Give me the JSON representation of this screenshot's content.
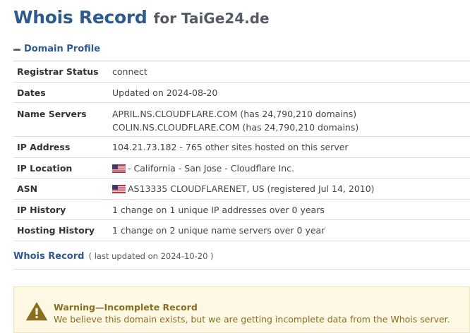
{
  "header": {
    "title": "Whois Record",
    "subtitle": "for TaiGe24.de"
  },
  "section": {
    "title": "Domain Profile"
  },
  "profile": [
    {
      "label": "Registrar Status",
      "lines": [
        "connect"
      ]
    },
    {
      "label": "Dates",
      "lines": [
        "Updated on 2024-08-20"
      ]
    },
    {
      "label": "Name Servers",
      "lines": [
        "APRIL.NS.CLOUDFLARE.COM (has 24,790,210 domains)",
        "COLIN.NS.CLOUDFLARE.COM (has 24,790,210 domains)"
      ]
    },
    {
      "label": "IP Address",
      "lines": [
        "104.21.73.182 - 765 other sites hosted on this server"
      ]
    },
    {
      "label": "IP Location",
      "lines": [
        "- California - San Jose - Cloudflare Inc."
      ],
      "flag": "us-flag"
    },
    {
      "label": "ASN",
      "lines": [
        "AS13335 CLOUDFLARENET, US (registered Jul 14, 2010)"
      ],
      "flag": "us-flag"
    },
    {
      "label": "IP History",
      "lines": [
        "1 change on 1 unique IP addresses over 0 years"
      ]
    },
    {
      "label": "Hosting History",
      "lines": [
        "1 change on 2 unique name servers over 0 year"
      ]
    }
  ],
  "record": {
    "title": "Whois Record",
    "updated": "( last updated on 2024-10-20 )"
  },
  "warning": {
    "title": "Warning—Incomplete Record",
    "message": "We believe this domain exists, but we are getting incomplete data from the Whois server.",
    "icon": "warning-triangle-icon"
  },
  "colors": {
    "title_blue": "#2e5a8e",
    "warning_bg": "#fcf8e3",
    "warning_text": "#8a6d1e",
    "warning_icon": "#8a6d1e"
  }
}
